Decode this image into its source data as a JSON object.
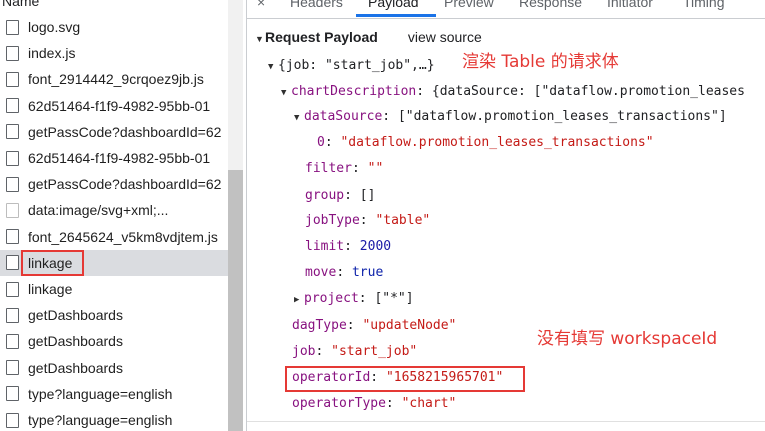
{
  "network": {
    "column_header": "Name",
    "requests": [
      {
        "name": "logo.svg"
      },
      {
        "name": "index.js"
      },
      {
        "name": "font_2914442_9crqoez9jb.js"
      },
      {
        "name": "62d51464-f1f9-4982-95bb-01"
      },
      {
        "name": "getPassCode?dashboardId=62"
      },
      {
        "name": "62d51464-f1f9-4982-95bb-01"
      },
      {
        "name": "getPassCode?dashboardId=62"
      },
      {
        "name": "data:image/svg+xml;..."
      },
      {
        "name": "font_2645624_v5km8vdjtem.js"
      },
      {
        "name": "linkage"
      },
      {
        "name": "linkage"
      },
      {
        "name": "getDashboards"
      },
      {
        "name": "getDashboards"
      },
      {
        "name": "getDashboards"
      },
      {
        "name": "type?language=english"
      },
      {
        "name": "type?language=english"
      }
    ],
    "selected_index": 9
  },
  "tabs": {
    "close": "×",
    "headers": "Headers",
    "payload": "Payload",
    "preview": "Preview",
    "response": "Response",
    "initiator": "Initiator",
    "timing": "Timing",
    "active": "Payload"
  },
  "payload": {
    "section_title": "Request Payload",
    "view_source": "view source",
    "root_summary": "{job: \"start_job\",…}",
    "chart_description_key": "chartDescription",
    "chart_description_summary": "{dataSource: [\"dataflow.promotion_leases",
    "data_source_key": "dataSource",
    "data_source_summary": "[\"dataflow.promotion_leases_transactions\"]",
    "data_source_item_index": "0",
    "data_source_item_value": "\"dataflow.promotion_leases_transactions\"",
    "filter_key": "filter",
    "filter_value": "\"\"",
    "group_key": "group",
    "group_value": "[]",
    "job_type_key": "jobType",
    "job_type_value": "\"table\"",
    "limit_key": "limit",
    "limit_value": "2000",
    "move_key": "move",
    "move_value": "true",
    "project_key": "project",
    "project_value": "[\"*\"]",
    "dag_type_key": "dagType",
    "dag_type_value": "\"updateNode\"",
    "job_key": "job",
    "job_value": "\"start_job\"",
    "operator_id_key": "operatorId",
    "operator_id_value": "\"1658215965701\"",
    "operator_type_key": "operatorType",
    "operator_type_value": "\"chart\""
  },
  "annotations": {
    "render_table_note": "渲染 Table 的请求体",
    "missing_workspace_note": "没有填写 workspaceId",
    "highlight_color": "#e53935"
  }
}
